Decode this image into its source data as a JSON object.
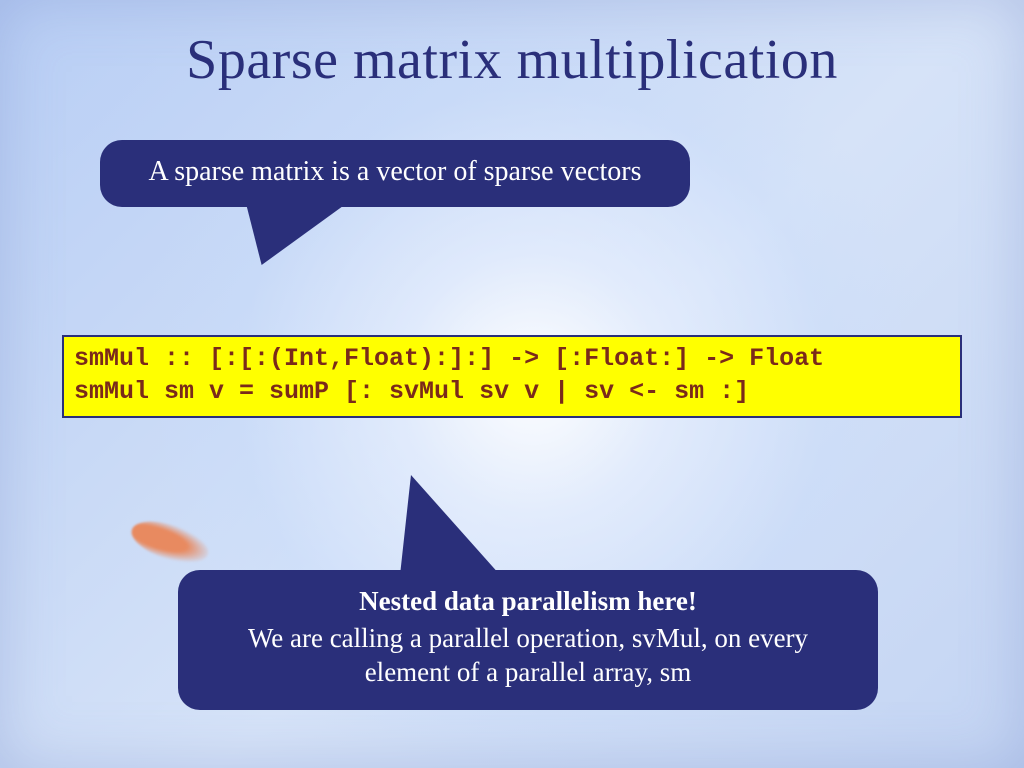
{
  "title": "Sparse matrix multiplication",
  "callout_top": "A sparse matrix is a vector of sparse vectors",
  "code": {
    "line1": "smMul :: [:[:(Int,Float):]:] -> [:Float:] -> Float",
    "line2": "smMul sm v = sumP [: svMul sv v | sv <- sm :]"
  },
  "callout_bottom": {
    "headline": "Nested data parallelism here!",
    "body": "We are calling a parallel operation, svMul, on every element of a parallel array, sm"
  }
}
